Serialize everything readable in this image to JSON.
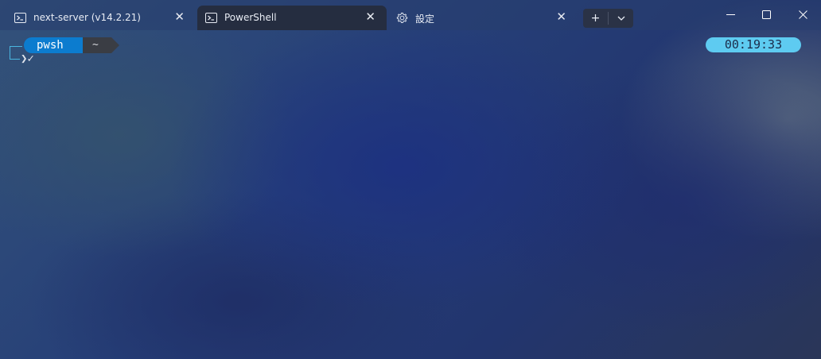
{
  "tabs": [
    {
      "label": "next-server (v14.2.21)",
      "icon": "powershell-icon"
    },
    {
      "label": "PowerShell",
      "icon": "powershell-icon"
    },
    {
      "label": "設定",
      "icon": "gear-icon"
    }
  ],
  "new_tab": {
    "plus": "+",
    "dropdown": "chevron-down-icon"
  },
  "window_controls": [
    "minimize-icon",
    "maximize-icon",
    "close-icon"
  ],
  "prompt": {
    "shell": "pwsh",
    "path": "~",
    "indicator": "❯✓",
    "clock": "00:19:33"
  },
  "colors": {
    "shell_segment": "#0c7ccf",
    "path_segment": "#3a3d44",
    "clock_segment": "#5ecbf1",
    "active_tab": "#252d40"
  }
}
